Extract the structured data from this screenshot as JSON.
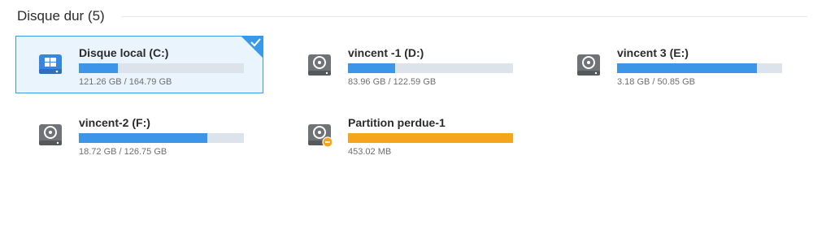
{
  "section": {
    "title": "Disque dur (5)"
  },
  "colors": {
    "bar_fill": "#3c95e6",
    "bar_track": "#dde3ea",
    "lost_fill": "#f4a51c",
    "selected_border": "#3a98e8",
    "selected_bg": "#eaf4fd"
  },
  "drives": [
    {
      "name": "Disque local (C:)",
      "size": "121.26 GB / 164.79 GB",
      "fill_fraction": 0.236,
      "icon": "windows-drive-icon",
      "selected": true
    },
    {
      "name": "vincent -1 (D:)",
      "size": "83.96 GB / 122.59 GB",
      "fill_fraction": 0.286,
      "icon": "hard-drive-icon",
      "selected": false
    },
    {
      "name": "vincent 3 (E:)",
      "size": "3.18 GB / 50.85 GB",
      "fill_fraction": 0.847,
      "icon": "hard-drive-icon",
      "selected": false
    },
    {
      "name": "vincent-2 (F:)",
      "size": "18.72 GB / 126.75 GB",
      "fill_fraction": 0.778,
      "icon": "hard-drive-icon",
      "selected": false
    },
    {
      "name": "Partition perdue-1",
      "size": "453.02 MB",
      "fill_fraction": 1.0,
      "icon": "lost-partition-icon",
      "selected": false
    }
  ]
}
